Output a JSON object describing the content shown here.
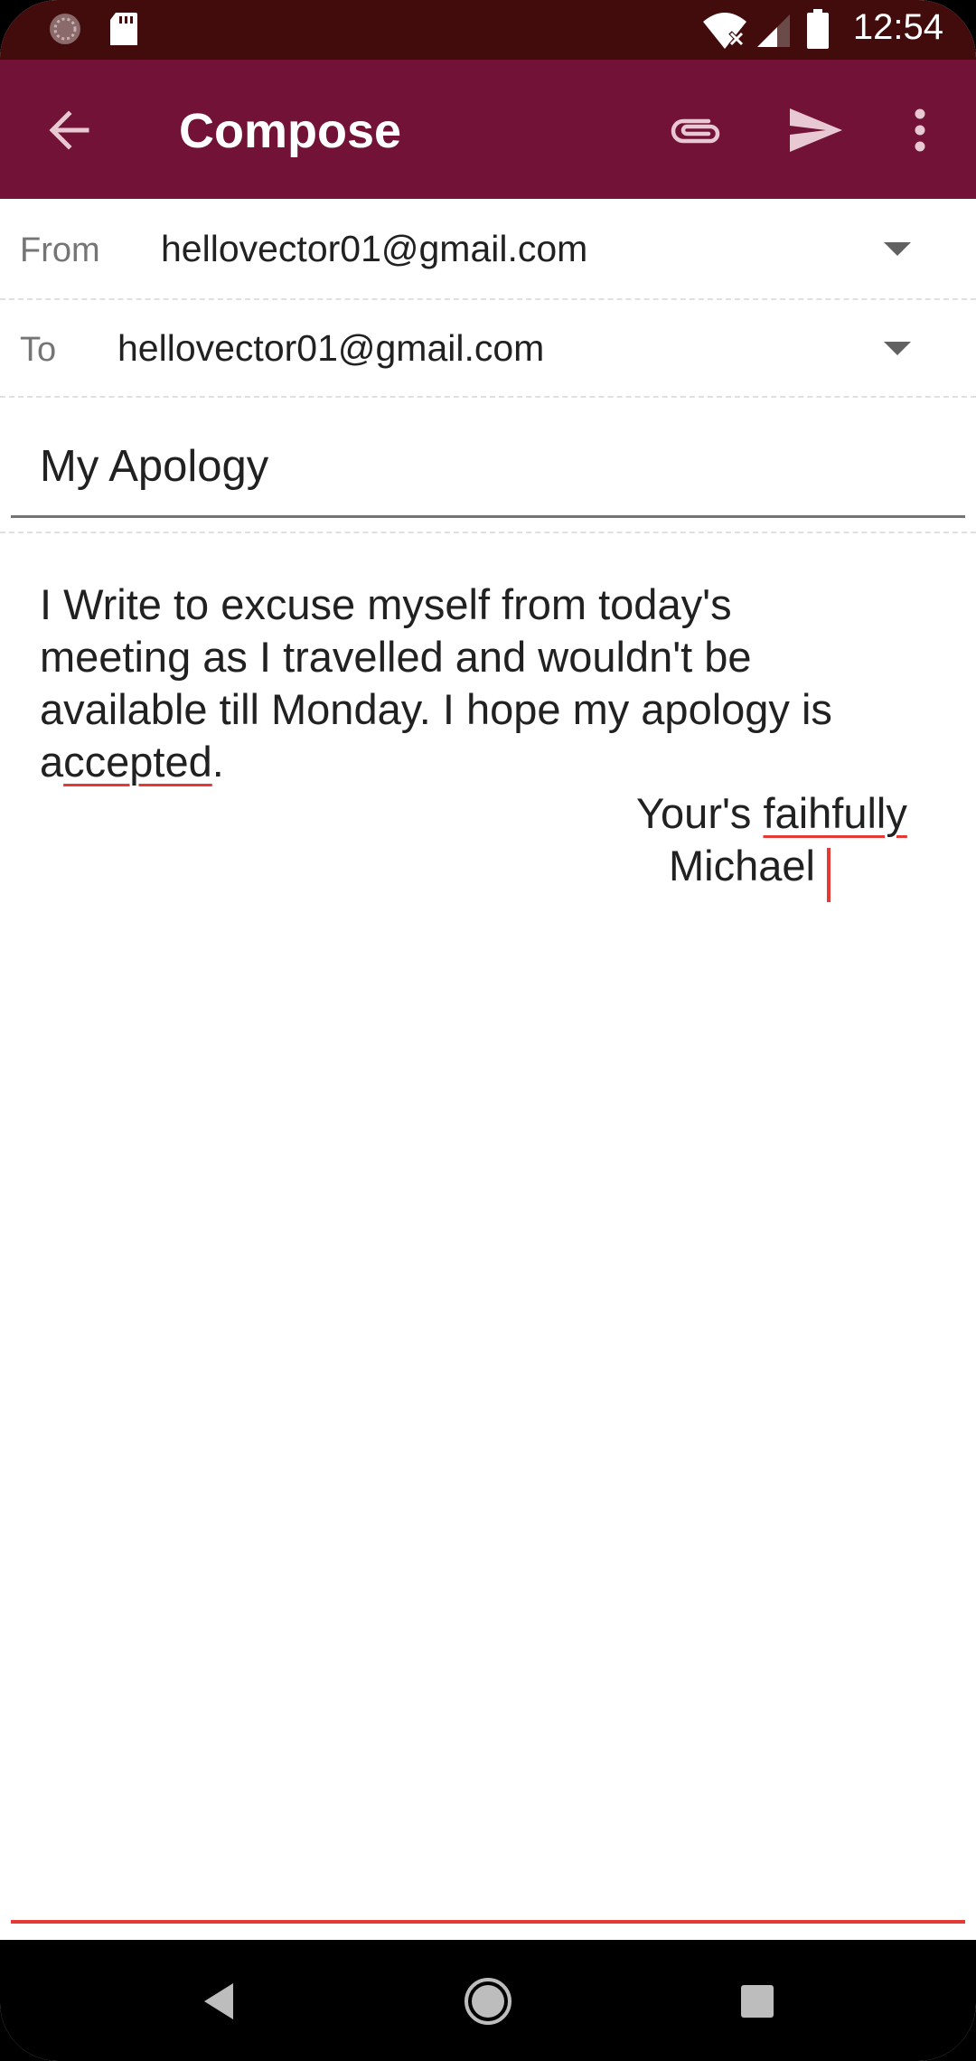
{
  "status_bar": {
    "time": "12:54",
    "icons": [
      "notification-dots-icon",
      "sd-card-icon",
      "wifi-off-icon",
      "cell-signal-icon",
      "battery-icon"
    ]
  },
  "app_bar": {
    "title": "Compose",
    "back_icon": "arrow-back-icon",
    "attach_icon": "paperclip-icon",
    "send_icon": "send-icon",
    "more_icon": "more-vert-icon"
  },
  "from": {
    "label": "From",
    "value": "hellovector01@gmail.com"
  },
  "to": {
    "label": "To",
    "value": "hellovector01@gmail.com"
  },
  "subject": {
    "value": "My Apology"
  },
  "body": {
    "line1": "I Write to excuse myself from today's",
    "line2": "meeting as I travelled and wouldn't be",
    "line3": "available till Monday. I hope my apology is",
    "line4_pre": "a",
    "line4_misspelled": "ccepted",
    "line4_post": ".",
    "sig_pre": "Your's ",
    "sig_misspelled": "faihfully",
    "sig_name": "Michael"
  },
  "colors": {
    "app_bar": "#721236",
    "status_bar": "#430c0c",
    "spellcheck": "#e53935"
  },
  "nav_bar": {
    "back": "nav-back-icon",
    "home": "nav-home-icon",
    "recents": "nav-recents-icon"
  }
}
